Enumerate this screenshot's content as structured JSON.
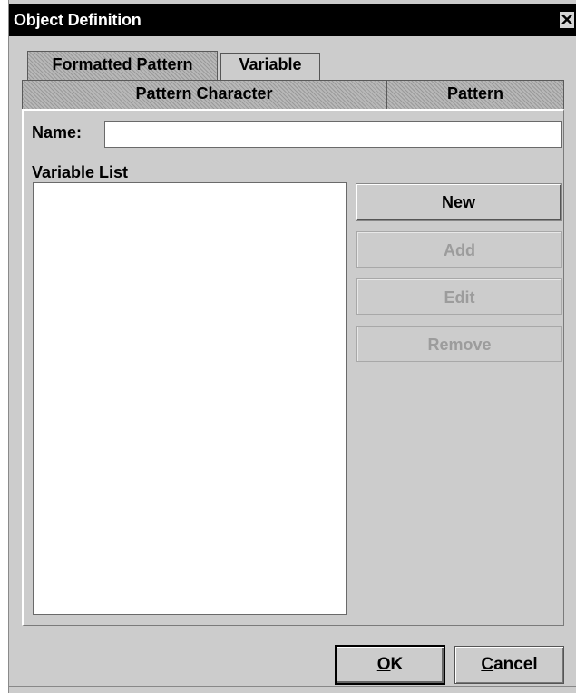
{
  "window": {
    "title": "Object Definition",
    "close_glyph": "✕"
  },
  "tabs": {
    "row_top": [
      {
        "label": "Formatted Pattern",
        "selected": false
      },
      {
        "label": "Variable",
        "selected": true
      }
    ],
    "row_bottom": [
      {
        "label": "Pattern Character",
        "selected": false
      },
      {
        "label": "Pattern",
        "selected": false
      }
    ]
  },
  "form": {
    "name_label": "Name:",
    "name_value": "",
    "variable_list_label": "Variable List",
    "variable_list_items": []
  },
  "list_buttons": {
    "new": {
      "label": "New",
      "enabled": true
    },
    "add": {
      "label": "Add",
      "enabled": false
    },
    "edit": {
      "label": "Edit",
      "enabled": false
    },
    "remove": {
      "label": "Remove",
      "enabled": false
    }
  },
  "dialog_buttons": {
    "ok": {
      "label": "OK",
      "mnemonic": "O",
      "rest": "K"
    },
    "cancel": {
      "label": "Cancel",
      "mnemonic": "C",
      "rest": "ancel"
    }
  },
  "icons": {
    "close": "close-icon"
  }
}
